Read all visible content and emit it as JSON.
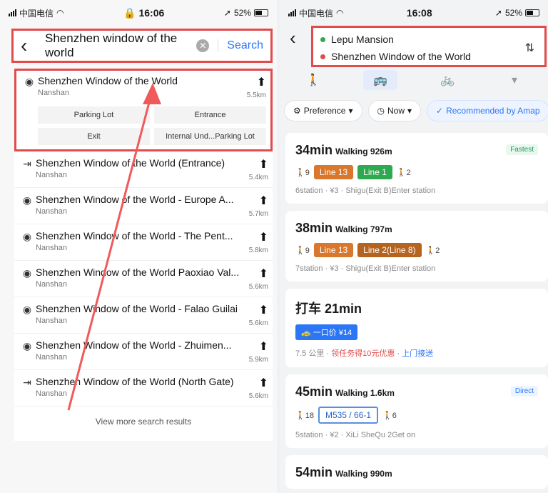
{
  "left": {
    "status": {
      "carrier": "中国电信",
      "time": "16:06",
      "battery": "52%"
    },
    "search": {
      "value": "Shenzhen window of the world",
      "button": "Search",
      "back": "‹"
    },
    "top_result": {
      "title": "Shenzhen Window of the World",
      "sub": "Nanshan",
      "distance": "5.5km",
      "subpois": [
        "Parking Lot",
        "Entrance",
        "Exit",
        "Internal Und...Parking Lot"
      ]
    },
    "results": [
      {
        "icon": "gate",
        "title": "Shenzhen Window of the World (Entrance)",
        "sub": "Nanshan",
        "distance": "5.4km"
      },
      {
        "icon": "pin",
        "title": "Shenzhen Window of the World - Europe A...",
        "sub": "Nanshan",
        "distance": "5.7km"
      },
      {
        "icon": "pin",
        "title": "Shenzhen Window of the World - The Pent...",
        "sub": "Nanshan",
        "distance": "5.8km"
      },
      {
        "icon": "pin",
        "title": "Shenzhen Window of the World Paoxiao Val...",
        "sub": "Nanshan",
        "distance": "5.6km"
      },
      {
        "icon": "pin",
        "title": "Shenzhen Window of the World - Falao Guilai",
        "sub": "Nanshan",
        "distance": "5.6km"
      },
      {
        "icon": "pin",
        "title": "Shenzhen Window of the World - Zhuimen...",
        "sub": "Nanshan",
        "distance": "5.9km"
      },
      {
        "icon": "gate",
        "title": "Shenzhen Window of the World (North Gate)",
        "sub": "Nanshan",
        "distance": "5.6km"
      }
    ],
    "more": "View more search results"
  },
  "right": {
    "status": {
      "carrier": "中国电信",
      "time": "16:08",
      "battery": "52%"
    },
    "from": "Lepu Mansion",
    "to": "Shenzhen Window of the World",
    "filters": {
      "pref": "Preference",
      "now": "Now",
      "rec": "Recommended by Amap"
    },
    "cards": [
      {
        "dur": "34min",
        "walk": "Walking 926m",
        "tag": "Fastest",
        "walk_start": "9",
        "lines": [
          "Line 13",
          "Line 1"
        ],
        "walk_end": "2",
        "meta": "6station · ¥3 · Shigu(Exit B)Enter station"
      },
      {
        "dur": "38min",
        "walk": "Walking 797m",
        "walk_start": "9",
        "lines": [
          "Line 13",
          "Line 2(Line 8)"
        ],
        "walk_end": "2",
        "meta": "7station · ¥3 · Shigu(Exit B)Enter station"
      }
    ],
    "taxi": {
      "title": "打车 21min",
      "badge": "一口价 ¥14",
      "meta_a": "7.5 公里 · ",
      "meta_b": "领任务得10元优惠",
      "meta_c": " · 上门接送"
    },
    "card3": {
      "dur": "45min",
      "walk": "Walking 1.6km",
      "tag": "Direct",
      "walk_start": "18",
      "line": "M535 / 66-1",
      "walk_end": "6",
      "meta": "5station · ¥2 · XiLi SheQu 2Get on"
    },
    "card4": {
      "dur": "54min",
      "walk": "Walking 990m"
    }
  },
  "colors": {
    "line13": "#d9772c",
    "line1": "#2fa84f",
    "line2": "#b5641f",
    "accent": "#2a76f6",
    "highlight": "#e24b4b"
  }
}
